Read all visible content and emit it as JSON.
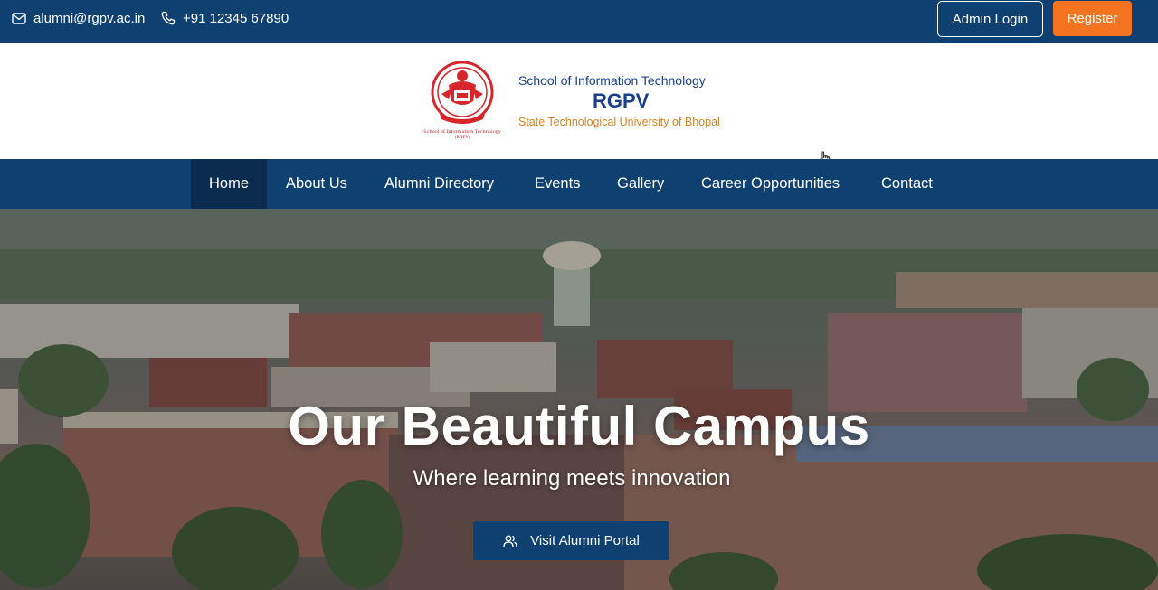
{
  "topbar": {
    "email": "alumni@rgpv.ac.in",
    "phone": "+91 12345 67890",
    "admin_login": "Admin Login",
    "register": "Register"
  },
  "header": {
    "school": "School of Information Technology",
    "name": "RGPV",
    "university": "State Technological University of Bhopal"
  },
  "nav": {
    "items": [
      "Home",
      "About Us",
      "Alumni Directory",
      "Events",
      "Gallery",
      "Career Opportunities",
      "Contact"
    ],
    "active": "Home"
  },
  "hero": {
    "title": "Our Beautiful Campus",
    "subtitle": "Where learning meets innovation",
    "cta": "Visit Alumni Portal"
  },
  "colors": {
    "primary": "#0f4072",
    "nav_active": "#0b2b4f",
    "accent": "#f47320",
    "brand_blue": "#1b3f8f",
    "brand_orange": "#d98324"
  },
  "icons": [
    "mail-icon",
    "phone-icon",
    "logo",
    "cursor-icon",
    "users-icon"
  ]
}
